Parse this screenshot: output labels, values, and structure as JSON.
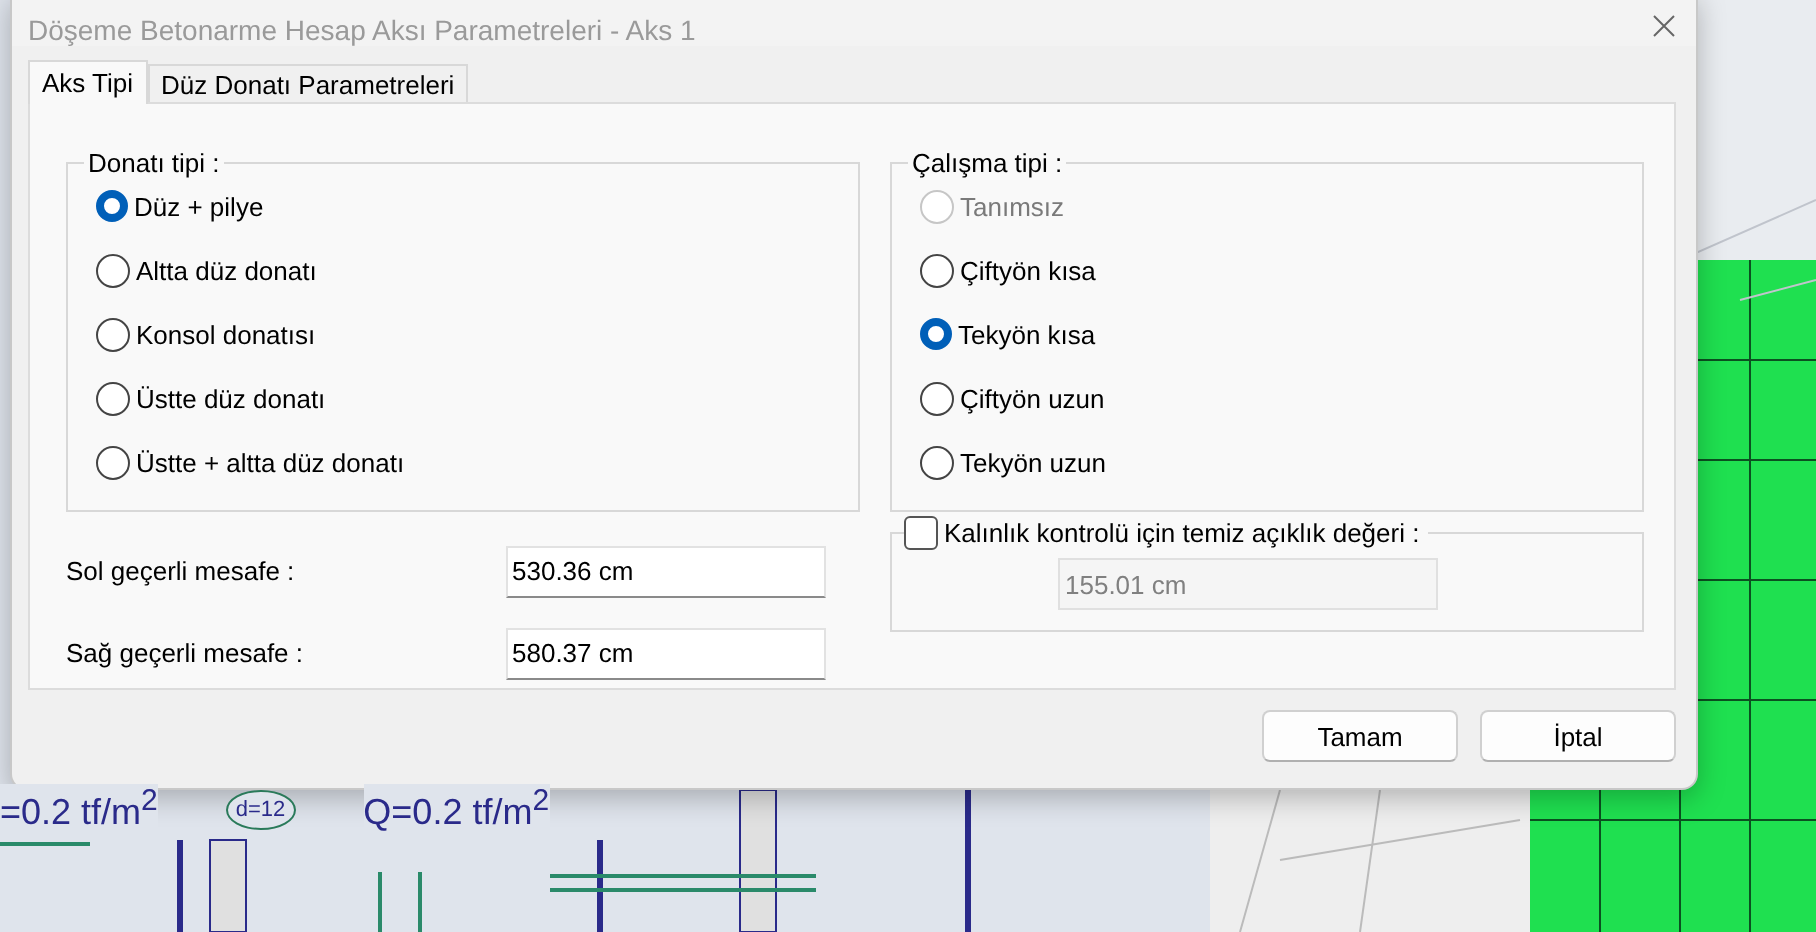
{
  "window": {
    "title": "Döşeme Betonarme Hesap Aksı Parametreleri - Aks 1"
  },
  "tabs": [
    {
      "label": "Aks Tipi",
      "selected": true
    },
    {
      "label": "Düz Donatı Parametreleri",
      "selected": false
    }
  ],
  "reinforcement_type": {
    "label": "Donatı tipi :",
    "options": [
      {
        "label": "Düz + pilye",
        "selected": true,
        "disabled": false
      },
      {
        "label": "Altta düz donatı",
        "selected": false,
        "disabled": false
      },
      {
        "label": "Konsol donatısı",
        "selected": false,
        "disabled": false
      },
      {
        "label": "Üstte düz donatı",
        "selected": false,
        "disabled": false
      },
      {
        "label": "Üstte + altta düz donatı",
        "selected": false,
        "disabled": false
      }
    ]
  },
  "working_type": {
    "label": "Çalışma tipi :",
    "options": [
      {
        "label": "Tanımsız",
        "selected": false,
        "disabled": true
      },
      {
        "label": "Çiftyön kısa",
        "selected": false,
        "disabled": false
      },
      {
        "label": "Tekyön kısa",
        "selected": true,
        "disabled": false
      },
      {
        "label": "Çiftyön uzun",
        "selected": false,
        "disabled": false
      },
      {
        "label": "Tekyön uzun",
        "selected": false,
        "disabled": false
      }
    ]
  },
  "distances": [
    {
      "label": "Sol geçerli mesafe :",
      "value": "530.36 cm"
    },
    {
      "label": "Sağ geçerli mesafe :",
      "value": "580.37 cm"
    }
  ],
  "thickness_check": {
    "label": "Kalınlık kontrolü için temiz açıklık değeri :",
    "checked": false,
    "value": "155.01 cm"
  },
  "buttons": [
    "Tamam",
    "İptal"
  ],
  "background": {
    "labels": [
      "=0.2 tf/m$^{2}$",
      "d=12",
      "Q=0.2 tf/m$^{2}$"
    ]
  }
}
